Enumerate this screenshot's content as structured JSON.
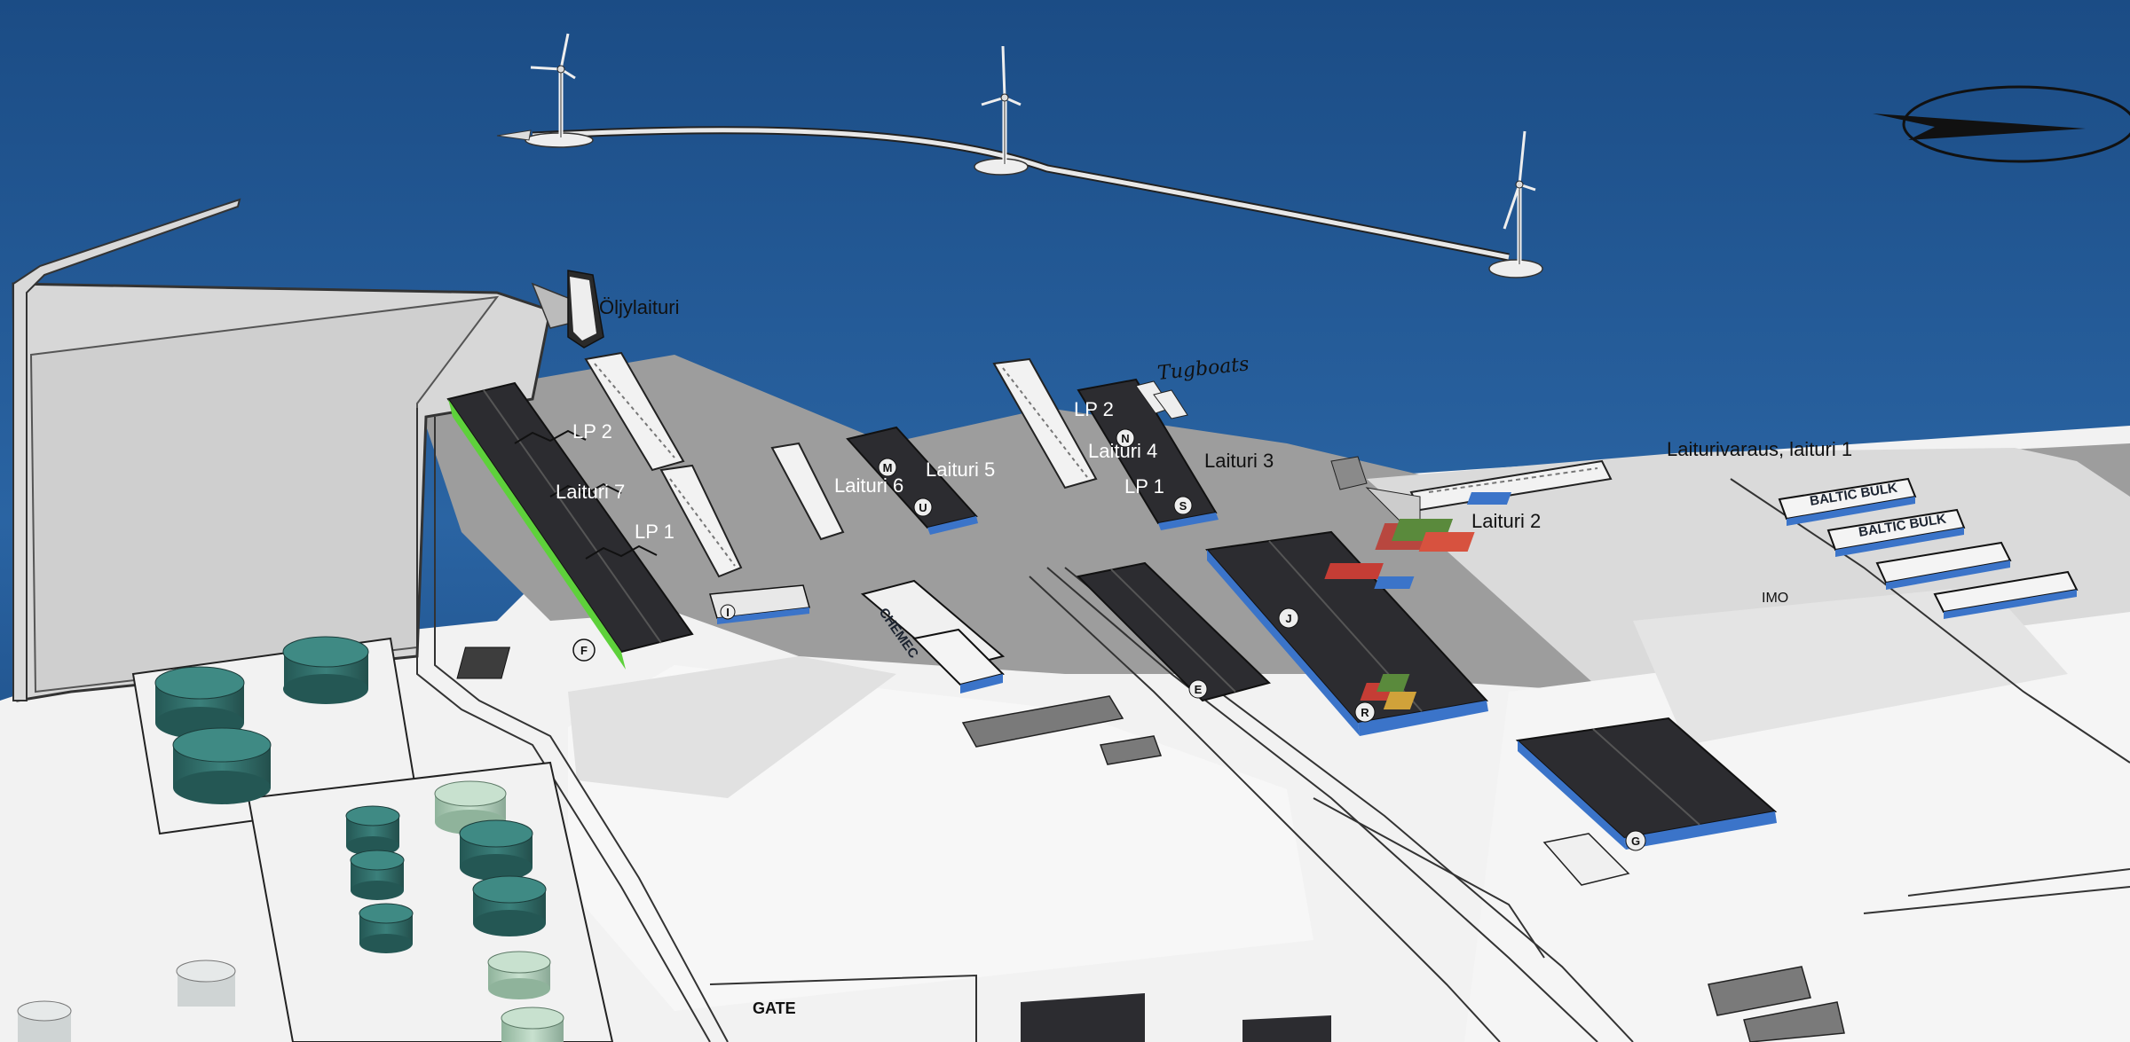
{
  "map": {
    "labels": {
      "oljylaituri": "Öljylaituri",
      "tugboats": "Tugboats",
      "lp2_west": "LP 2",
      "laituri7": "Laituri 7",
      "lp1_west": "LP 1",
      "laituri6": "Laituri 6",
      "laituri5": "Laituri 5",
      "lp2_east": "LP 2",
      "laituri4": "Laituri 4",
      "lp1_east": "LP 1",
      "laituri3": "Laituri 3",
      "laituri2": "Laituri 2",
      "laiturivaraus": "Laiturivaraus, laituri 1",
      "imo": "IMO",
      "gate": "GATE",
      "chemec": "CHEMEC"
    },
    "warehouse_signs": [
      "BALTIC BULK",
      "BALTIC BULK"
    ],
    "building_letters": {
      "f": "F",
      "i": "I",
      "m": "M",
      "u": "U",
      "n": "N",
      "s": "S",
      "j": "J",
      "r": "R",
      "e": "E",
      "g": "G"
    },
    "colors": {
      "sea": "#1f4f86",
      "land": "#9e9e9e",
      "roof": "#2f2f33",
      "warehouse_blue": "#3b74c9",
      "highlight_green": "#5ed13b",
      "tank_teal": "#2f6e6b",
      "tank_light": "#a9c9b4"
    }
  }
}
